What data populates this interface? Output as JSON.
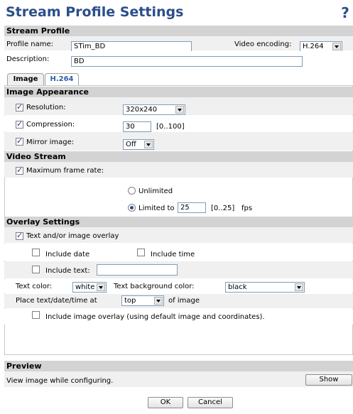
{
  "page": {
    "title": "Stream Profile Settings"
  },
  "stream_profile": {
    "heading": "Stream Profile",
    "profile_name_label": "Profile name:",
    "profile_name_value": "STim_BD",
    "video_encoding_label": "Video encoding:",
    "video_encoding_value": "H.264",
    "description_label": "Description:",
    "description_value": "BD"
  },
  "tabs": [
    {
      "label": "Image",
      "active": true
    },
    {
      "label": "H.264",
      "active": false
    }
  ],
  "image_appearance": {
    "heading": "Image Appearance",
    "resolution_label": "Resolution:",
    "resolution_value": "320x240",
    "compression_label": "Compression:",
    "compression_value": "30",
    "compression_range": "[0..100]",
    "mirror_label": "Mirror image:",
    "mirror_value": "Off"
  },
  "video_stream": {
    "heading": "Video Stream",
    "max_frame_rate_label": "Maximum frame rate:",
    "unlimited_label": "Unlimited",
    "limited_label": "Limited to",
    "limited_value": "25",
    "limited_range": "[0..25]",
    "fps_label": "fps"
  },
  "overlay": {
    "heading": "Overlay Settings",
    "text_image_overlay_label": "Text and/or image overlay",
    "include_date_label": "Include date",
    "include_time_label": "Include time",
    "include_text_label": "Include text:",
    "include_text_value": "",
    "text_color_label": "Text color:",
    "text_color_value": "white",
    "text_bg_color_label": "Text background color:",
    "text_bg_color_value": "black",
    "place_label": "Place text/date/time at",
    "place_value": "top",
    "of_image_label": "of image",
    "include_image_overlay_label": "Include image overlay (using default image and coordinates)."
  },
  "preview": {
    "heading": "Preview",
    "description": "View image while configuring.",
    "show_label": "Show"
  },
  "footer": {
    "ok_label": "OK",
    "cancel_label": "Cancel"
  }
}
